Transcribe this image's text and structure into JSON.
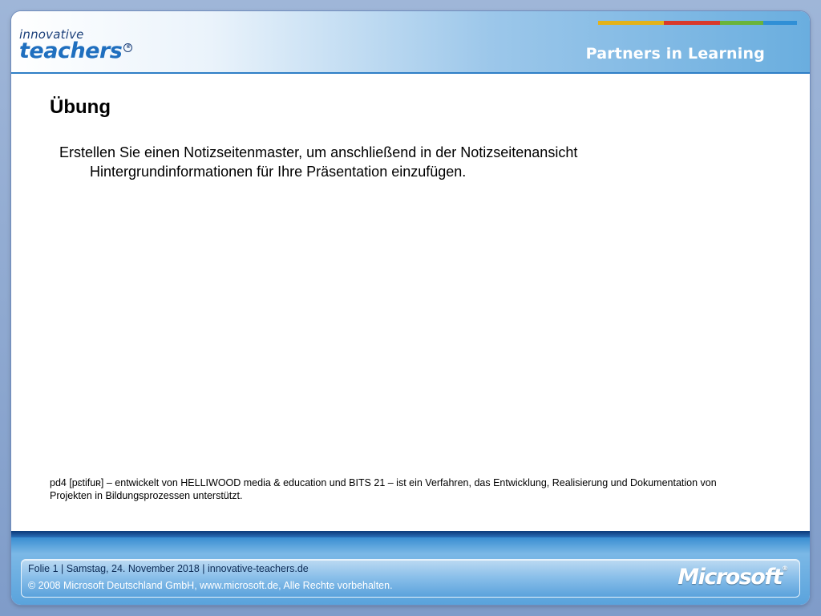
{
  "header": {
    "logo_top": "innovative",
    "logo_main": "teachers",
    "logo_mark": "®",
    "tagline": "Partners in Learning",
    "stripe_colors": [
      "#e3b21a",
      "#d8392b",
      "#6ab43a",
      "#2f8fd6"
    ]
  },
  "slide": {
    "title": "Übung",
    "body": "Erstellen Sie einen Notizseitenmaster, um anschließend in der Notizseitenansicht Hintergrundinformationen für Ihre Präsentation einzufügen.",
    "note": "pd4 [pɛtifuʀ] – entwickelt von HELLIWOOD media & education und BITS 21 – ist ein Verfahren, das Entwicklung, Realisierung und Dokumentation von Projekten in Bildungsprozessen unterstützt."
  },
  "footer": {
    "line1": "Folie 1 | Samstag, 24. November 2018 | innovative-teachers.de",
    "line2": "© 2008 Microsoft Deutschland GmbH, www.microsoft.de, Alle Rechte vorbehalten.",
    "brand": "Microsoft",
    "brand_mark": "®"
  }
}
